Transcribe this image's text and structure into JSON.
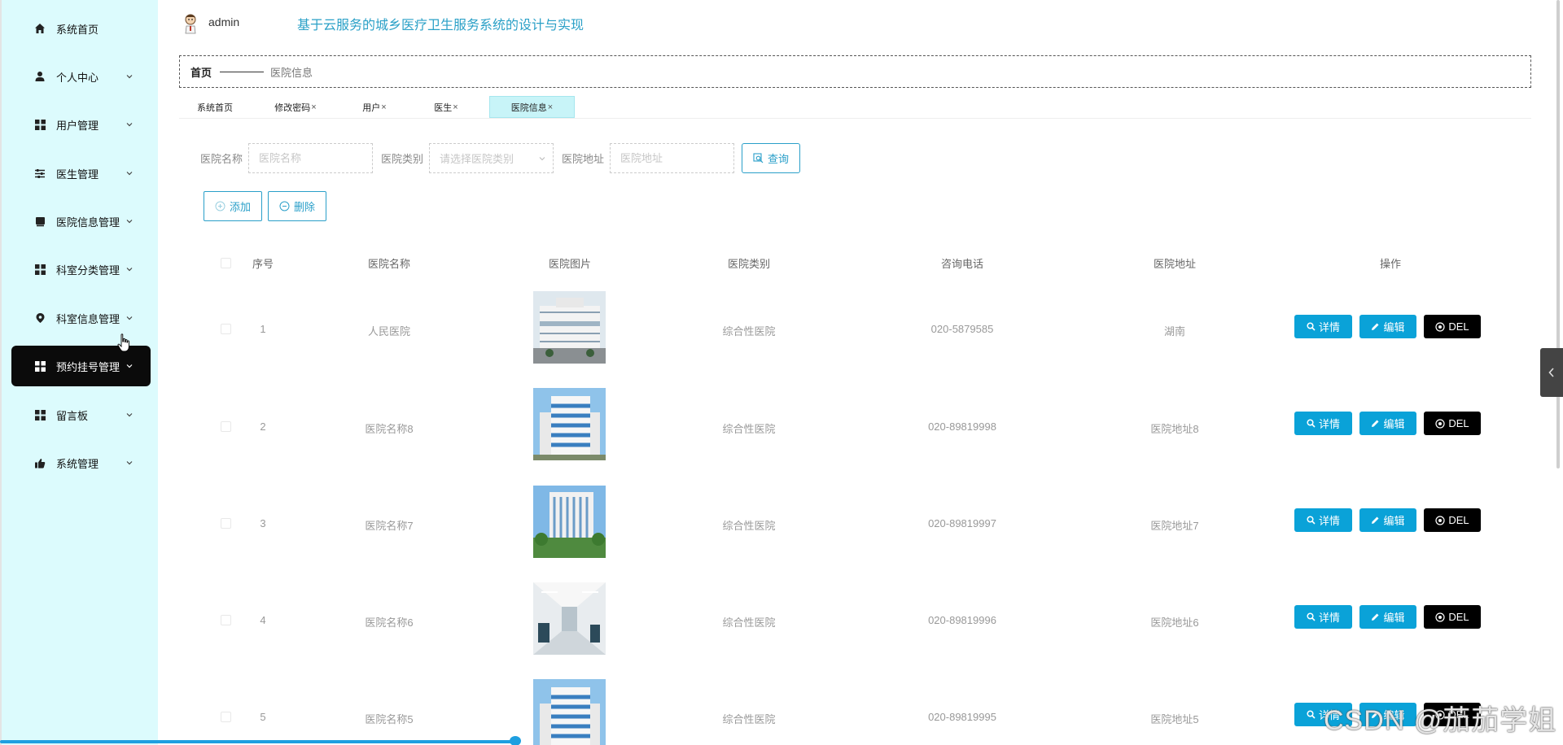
{
  "sidebar": {
    "items": [
      {
        "label": "系统首页",
        "icon": "home-icon",
        "chevron": false,
        "active": false
      },
      {
        "label": "个人中心",
        "icon": "user-icon",
        "chevron": true,
        "active": false
      },
      {
        "label": "用户管理",
        "icon": "grid-icon",
        "chevron": true,
        "active": false
      },
      {
        "label": "医生管理",
        "icon": "sliders-icon",
        "chevron": true,
        "active": false
      },
      {
        "label": "医院信息管理",
        "icon": "book-icon",
        "chevron": true,
        "active": false
      },
      {
        "label": "科室分类管理",
        "icon": "grid-icon",
        "chevron": true,
        "active": false
      },
      {
        "label": "科室信息管理",
        "icon": "location-icon",
        "chevron": true,
        "active": false
      },
      {
        "label": "预约挂号管理",
        "icon": "grid-icon",
        "chevron": true,
        "active": true
      },
      {
        "label": "留言板",
        "icon": "grid-icon",
        "chevron": true,
        "active": false
      },
      {
        "label": "系统管理",
        "icon": "thumb-icon",
        "chevron": true,
        "active": false
      }
    ]
  },
  "header": {
    "username": "admin",
    "title": "基于云服务的城乡医疗卫生服务系统的设计与实现"
  },
  "breadcrumb": {
    "home": "首页",
    "current": "医院信息"
  },
  "tabs": [
    {
      "label": "系统首页",
      "closable": false,
      "active": false
    },
    {
      "label": "修改密码",
      "closable": true,
      "active": false
    },
    {
      "label": "用户",
      "closable": true,
      "active": false
    },
    {
      "label": "医生",
      "closable": true,
      "active": false
    },
    {
      "label": "医院信息",
      "closable": true,
      "active": true
    }
  ],
  "search": {
    "name_label": "医院名称",
    "name_placeholder": "医院名称",
    "type_label": "医院类别",
    "type_placeholder": "请选择医院类别",
    "address_label": "医院地址",
    "address_placeholder": "医院地址",
    "query_label": "查询"
  },
  "actions": {
    "add_label": "添加",
    "delete_label": "删除"
  },
  "table": {
    "columns": [
      "序号",
      "医院名称",
      "医院图片",
      "医院类别",
      "咨询电话",
      "医院地址",
      "操作"
    ],
    "rows": [
      {
        "index": "1",
        "name": "人民医院",
        "type": "综合性医院",
        "phone": "020-5879585",
        "address": "湖南"
      },
      {
        "index": "2",
        "name": "医院名称8",
        "type": "综合性医院",
        "phone": "020-89819998",
        "address": "医院地址8"
      },
      {
        "index": "3",
        "name": "医院名称7",
        "type": "综合性医院",
        "phone": "020-89819997",
        "address": "医院地址7"
      },
      {
        "index": "4",
        "name": "医院名称6",
        "type": "综合性医院",
        "phone": "020-89819996",
        "address": "医院地址6"
      },
      {
        "index": "5",
        "name": "医院名称5",
        "type": "综合性医院",
        "phone": "020-89819995",
        "address": "医院地址5"
      }
    ],
    "row_buttons": {
      "detail": "详情",
      "edit": "编辑",
      "del": "DEL"
    }
  },
  "watermark": "CSDN @茄茄学姐",
  "colors": {
    "sidebar_bg": "#dcfbfd",
    "accent": "#0aa2d8",
    "title": "#2aa0c7",
    "active_menu": "#0b0b0b"
  }
}
